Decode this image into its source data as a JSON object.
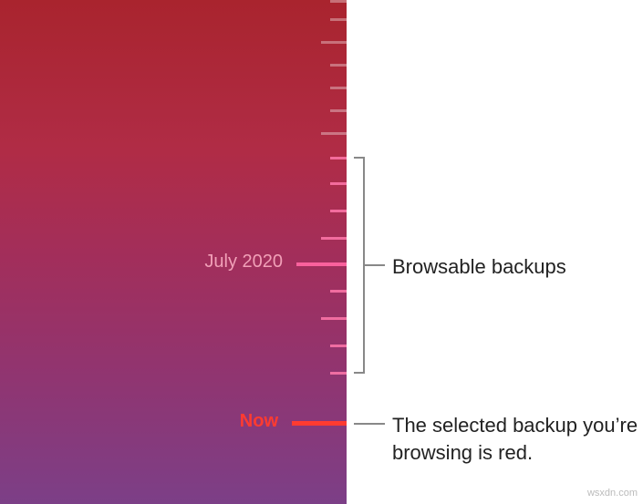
{
  "timeline": {
    "date_label": "July 2020",
    "now_label": "Now"
  },
  "annotations": {
    "browsable": "Browsable backups",
    "selected": "The selected backup you’re browsing is red."
  },
  "watermark": "wsxdn.com"
}
